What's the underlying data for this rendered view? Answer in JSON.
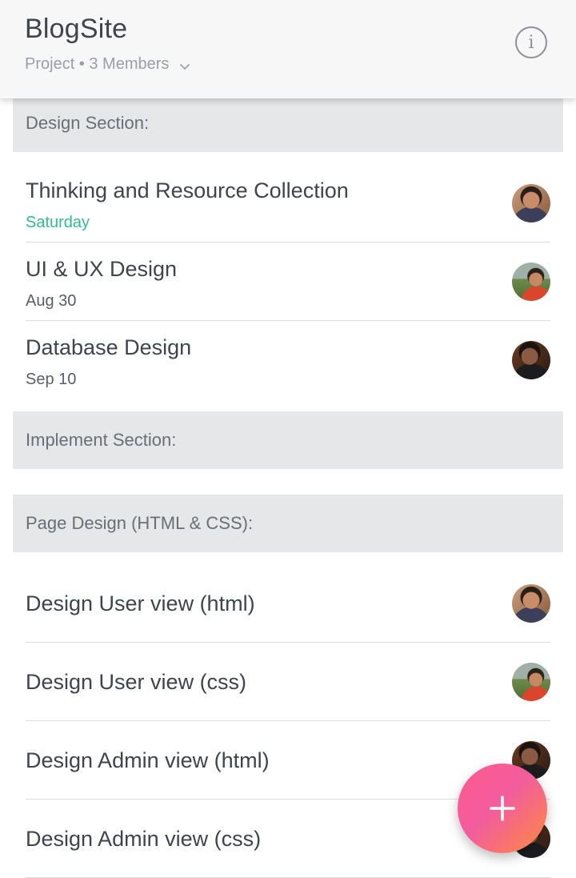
{
  "header": {
    "title": "BlogSite",
    "subtitle": "Project • 3 Members"
  },
  "sections": [
    {
      "label": "Design  Section:",
      "tasks": [
        {
          "title": "Thinking and Resource Collection",
          "date": "Saturday",
          "date_color": "#2fbf8c",
          "avatar": "member-1"
        },
        {
          "title": "UI & UX Design",
          "date": "Aug 30",
          "avatar": "member-2"
        },
        {
          "title": "Database Design",
          "date": "Sep 10",
          "avatar": "member-3"
        }
      ]
    },
    {
      "label": "Implement Section:",
      "tasks": []
    },
    {
      "label": "Page Design (HTML & CSS):",
      "tasks": [
        {
          "title": "Design User view (html)",
          "avatar": "member-1"
        },
        {
          "title": "Design User view (css)",
          "avatar": "member-2"
        },
        {
          "title": "Design Admin view (html)",
          "avatar": "member-3"
        },
        {
          "title": "Design Admin view (css)",
          "avatar": "member-3"
        }
      ]
    }
  ],
  "icons": {
    "info": "info-icon",
    "dropdown": "chevron-down-icon",
    "add": "plus-icon"
  },
  "colors": {
    "accent_green": "#2fbf8c",
    "fab_gradient_start": "#ff5a8a",
    "fab_gradient_end": "#ff8a3d",
    "section_bg": "#e6e7e9",
    "header_bg": "#f7f7f8"
  }
}
